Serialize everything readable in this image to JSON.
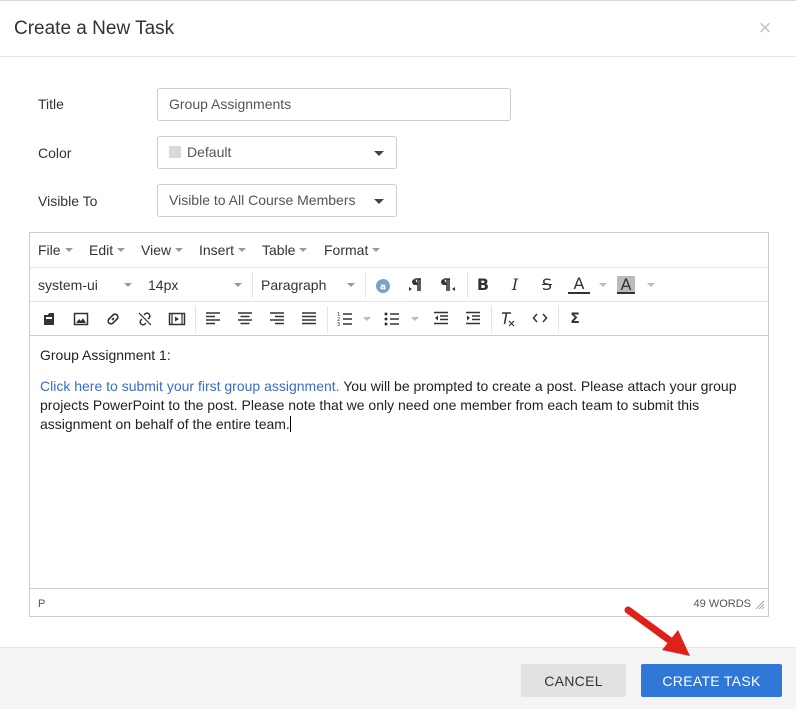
{
  "dialog": {
    "title": "Create a New Task",
    "close_symbol": "×"
  },
  "form": {
    "title_label": "Title",
    "title_value": "Group Assignments",
    "color_label": "Color",
    "color_value": "Default",
    "visible_label": "Visible To",
    "visible_value": "Visible to All Course Members"
  },
  "editor": {
    "menu": [
      "File",
      "Edit",
      "View",
      "Insert",
      "Table",
      "Format"
    ],
    "font_family": "system-ui",
    "font_size": "14px",
    "block_format": "Paragraph",
    "content": {
      "heading": "Group Assignment 1:",
      "link_text": "Click here to submit your first group assignment.",
      "body_text": " You will be prompted to create a post. Please attach your group projects PowerPoint to the post. Please note that we only need one member from each team to submit this assignment on behalf of the entire team."
    },
    "status_path": "P",
    "word_count": "49 WORDS"
  },
  "footer": {
    "cancel_label": "CANCEL",
    "create_label": "CREATE TASK"
  },
  "colors": {
    "primary": "#2f78d8",
    "link": "#3a6cc9",
    "annotation_arrow": "#e0201b"
  },
  "icons": [
    "close-icon",
    "spellcheck-icon",
    "ltr-icon",
    "rtl-icon",
    "bold-icon",
    "italic-icon",
    "strikethrough-icon",
    "text-color-icon",
    "highlight-color-icon",
    "insert-file-icon",
    "insert-image-icon",
    "link-icon",
    "unlink-icon",
    "insert-media-icon",
    "align-left-icon",
    "align-center-icon",
    "align-right-icon",
    "align-justify-icon",
    "numbered-list-icon",
    "bullet-list-icon",
    "outdent-icon",
    "indent-icon",
    "clear-formatting-icon",
    "code-icon",
    "equation-icon",
    "resize-grip-icon",
    "red-arrow-icon"
  ]
}
